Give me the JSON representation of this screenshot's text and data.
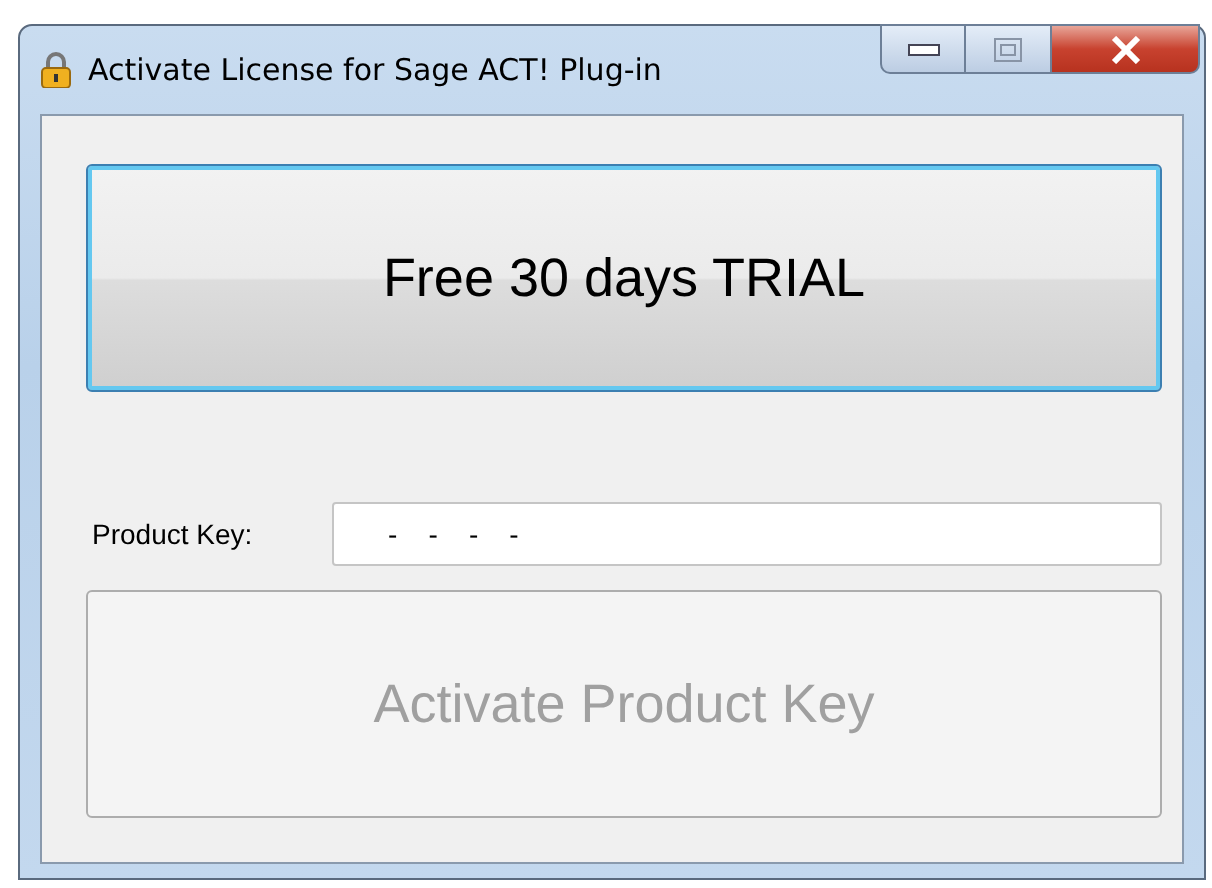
{
  "window": {
    "title": "Activate License for Sage ACT! Plug-in"
  },
  "trial_button": {
    "label": "Free 30 days TRIAL",
    "focused": true
  },
  "product_key": {
    "label": "Product Key:",
    "value": "-    -    -    -"
  },
  "activate_button": {
    "label": "Activate Product Key",
    "disabled": true
  }
}
